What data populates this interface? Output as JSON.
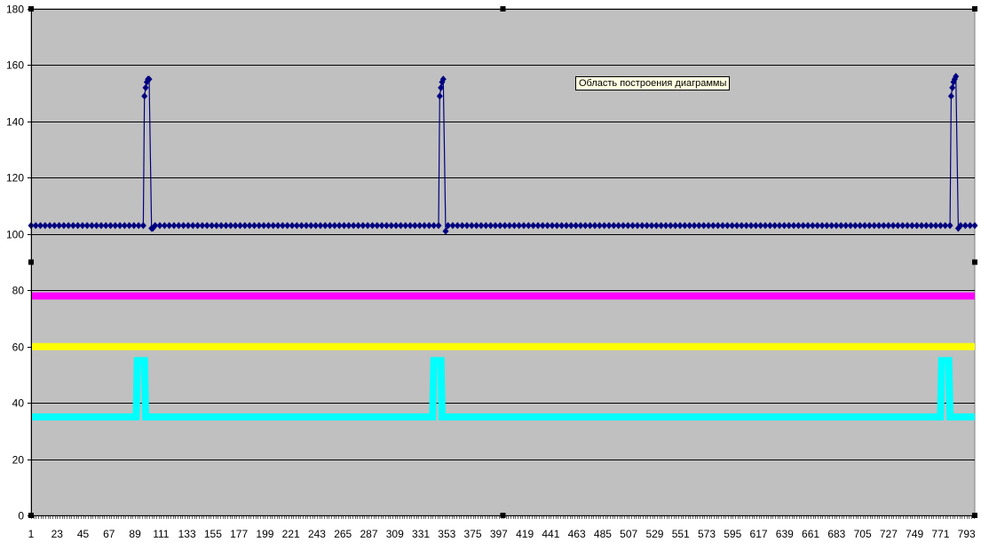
{
  "chart_data": {
    "type": "line",
    "title": "",
    "xlabel": "",
    "ylabel": "",
    "ylim": [
      0,
      180
    ],
    "xlim": [
      1,
      800
    ],
    "y_ticks": [
      0,
      20,
      40,
      60,
      80,
      100,
      120,
      140,
      160,
      180
    ],
    "x_ticks": [
      1,
      23,
      45,
      67,
      89,
      111,
      133,
      155,
      177,
      199,
      221,
      243,
      265,
      287,
      309,
      331,
      353,
      375,
      397,
      419,
      441,
      463,
      485,
      507,
      529,
      551,
      573,
      595,
      617,
      639,
      661,
      683,
      705,
      727,
      749,
      771,
      793
    ],
    "grid": true,
    "plot_area_color": "#c0c0c0",
    "legend": "none",
    "series": [
      {
        "color": "#000080",
        "marker": "diamond",
        "points": [
          [
            1,
            103
          ],
          [
            96,
            103
          ],
          [
            97,
            149
          ],
          [
            98,
            152
          ],
          [
            99,
            154
          ],
          [
            100,
            155
          ],
          [
            101,
            155
          ],
          [
            103,
            102
          ],
          [
            104,
            102
          ],
          [
            106,
            103
          ],
          [
            346,
            103
          ],
          [
            347,
            149
          ],
          [
            348,
            152
          ],
          [
            349,
            154
          ],
          [
            350,
            155
          ],
          [
            352,
            101
          ],
          [
            354,
            103
          ],
          [
            779,
            103
          ],
          [
            780,
            149
          ],
          [
            781,
            152
          ],
          [
            782,
            154
          ],
          [
            783,
            155
          ],
          [
            784,
            156
          ],
          [
            786,
            102
          ],
          [
            788,
            103
          ],
          [
            800,
            103
          ]
        ]
      },
      {
        "color": "#ff00ff",
        "points": [
          [
            1,
            78
          ],
          [
            800,
            78
          ]
        ]
      },
      {
        "color": "#ffff00",
        "points": [
          [
            1,
            60
          ],
          [
            800,
            60
          ]
        ]
      },
      {
        "color": "#00ffff",
        "points": [
          [
            1,
            35
          ],
          [
            90,
            35
          ],
          [
            91,
            55
          ],
          [
            97,
            55
          ],
          [
            98,
            35
          ],
          [
            341,
            35
          ],
          [
            342,
            55
          ],
          [
            348,
            55
          ],
          [
            349,
            35
          ],
          [
            771,
            35
          ],
          [
            772,
            55
          ],
          [
            778,
            55
          ],
          [
            779,
            35
          ],
          [
            800,
            35
          ]
        ]
      }
    ]
  },
  "tooltip": {
    "text": "Область построения диаграммы"
  }
}
